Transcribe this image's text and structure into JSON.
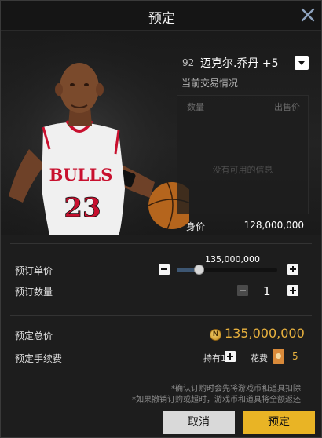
{
  "dialog": {
    "title": "预定",
    "close_icon": "close-icon"
  },
  "player": {
    "ovr": "92",
    "name": "迈克尔.乔丹 +5",
    "jersey_team": "BULLS",
    "jersey_number": "23",
    "art_colors": {
      "jersey": "#f0f0f0",
      "trim": "#c8102e",
      "skin": "#7a4a2c",
      "ball": "#b5651d"
    }
  },
  "market": {
    "subtitle": "当前交易情况",
    "columns": {
      "quantity": "数量",
      "price": "出售价"
    },
    "empty_text": "没有可用的信息"
  },
  "worth": {
    "label": "身价",
    "value": "128,000,000"
  },
  "unit_price": {
    "label": "预订单价",
    "value": "135,000,000",
    "slider_fraction": 0.22
  },
  "quantity": {
    "label": "预订数量",
    "value": "1"
  },
  "total": {
    "label": "预定总价",
    "coin_icon": "coin-icon",
    "coin_glyph": "N",
    "value": "135,000,000"
  },
  "fee": {
    "label": "预定手续费",
    "hold_label": "持有10",
    "spend_label": "花费",
    "ticket_icon": "ticket-icon",
    "value": "5"
  },
  "notes": [
    "*确认订购时会先将游戏币和道具扣除",
    "*如果撤销订购或超时，游戏币和道具将全额返还"
  ],
  "buttons": {
    "cancel": "取消",
    "confirm": "预定"
  },
  "colors": {
    "accent_gold": "#e9b425",
    "price_gold": "#e8b13e",
    "background": "#1d1d1d"
  }
}
